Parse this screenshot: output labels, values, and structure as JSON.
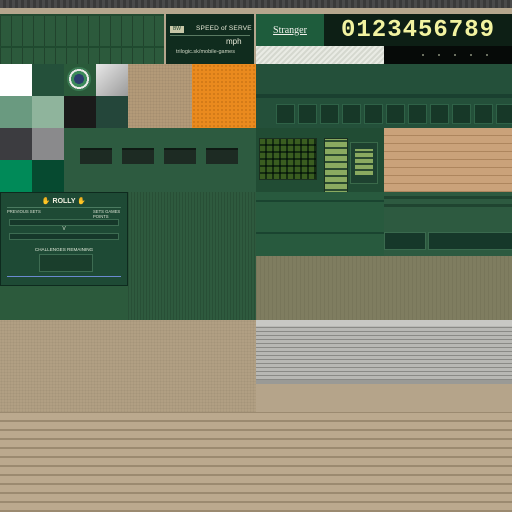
{
  "speed_panel": {
    "logo_text": "BW",
    "title": "SPEED of SERVE",
    "unit": "mph",
    "url": "trilogic.sk/mobile-games"
  },
  "player_label": "Stranger",
  "digits": "0123456789",
  "scoreboard": {
    "title": "ROLLY",
    "left_caption": "PREVIOUS SETS",
    "right_caption": "SETS GAMES POINTS",
    "versus": "V",
    "challenges": "CHALLENGES REMAINING"
  },
  "colors": {
    "swatch_white": "#ffffff",
    "swatch_grey_light": "#b0b0b0",
    "swatch_green_grey": "#6a9a80",
    "swatch_green_light": "#8fb49c",
    "swatch_black": "#1a1a1a",
    "swatch_dark_green": "#24463a",
    "swatch_charcoal": "#3c3c40",
    "swatch_grey_mid": "#8a8a8c",
    "swatch_teal": "#008a58",
    "swatch_forest": "#064a30",
    "digits": "#f2f3a0",
    "court_orange": "#ea8a1e"
  },
  "icons": [
    "tournament-logo-icon",
    "speaker-icon",
    "hand-icon"
  ]
}
